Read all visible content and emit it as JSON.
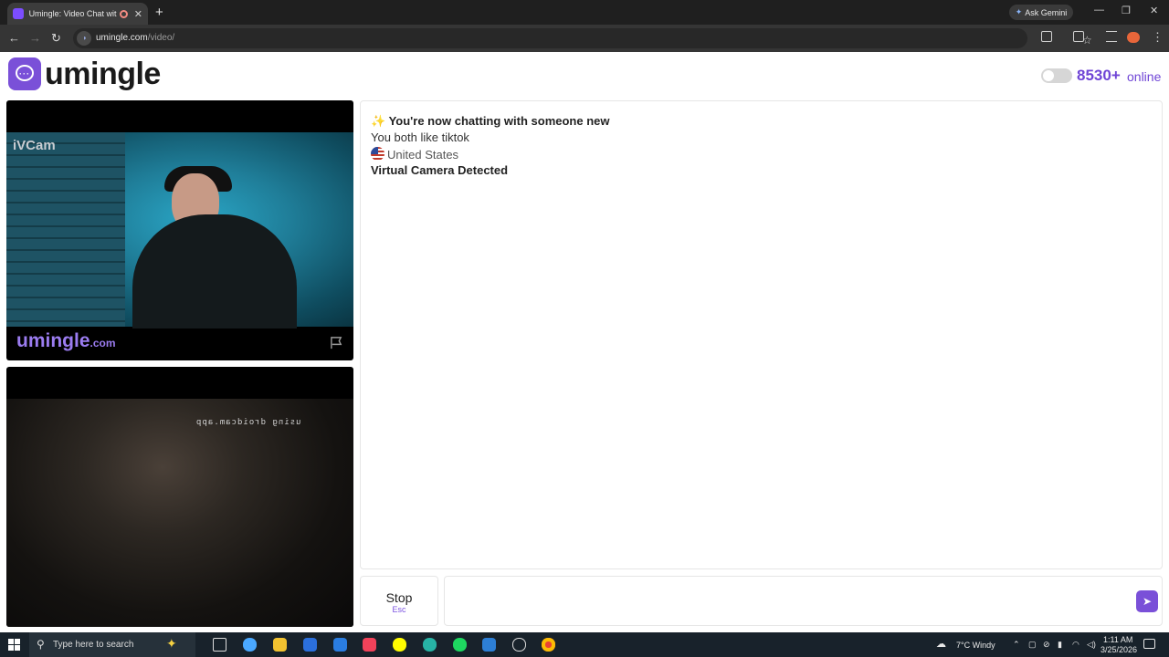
{
  "browser": {
    "tab_title": "Umingle: Video Chat with S",
    "tab_close": "✕",
    "new_tab": "+",
    "gemini_label": "Ask Gemini",
    "url_host": "umingle.com",
    "url_path": "/video/",
    "nav_back": "←",
    "nav_forward": "→",
    "nav_reload": "↻",
    "bookmark": "☆",
    "menu": "⋮",
    "minimize": "—",
    "restore": "❐",
    "close": "✕"
  },
  "header": {
    "logo_text": "umingle",
    "online_count": "8530+",
    "online_label": "online"
  },
  "video": {
    "camera_label": "iVCam",
    "watermark": "umingle",
    "watermark_suffix": ".com",
    "remote_overlay": "using droidcam.app"
  },
  "chat": {
    "messages": [
      "You're now chatting with someone new",
      "You both like tiktok",
      "United States",
      "Virtual Camera Detected"
    ]
  },
  "controls": {
    "stop_label": "Stop",
    "stop_shortcut": "Esc",
    "send": "➤"
  },
  "taskbar": {
    "search_placeholder": "Type here to search",
    "weather": "7°C  Windy",
    "time": "1:11 AM",
    "date": "3/25/2026"
  },
  "colors": {
    "brand": "#7a50d8",
    "online": "#6f45d6"
  }
}
